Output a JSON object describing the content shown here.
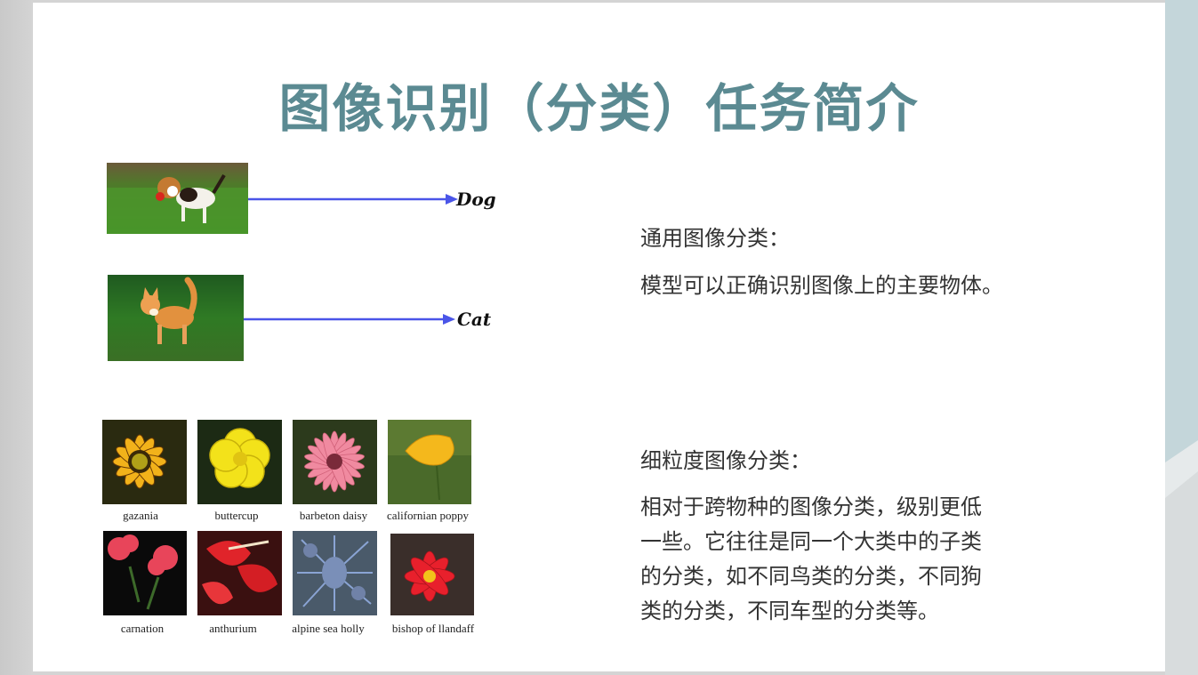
{
  "slide": {
    "title": "图像识别（分类）任务简介"
  },
  "general": {
    "heading": "通用图像分类：",
    "body": "模型可以正确识别图像上的主要物体。"
  },
  "fine_grained": {
    "heading": "细粒度图像分类：",
    "lines": [
      "相对于跨物种的图像分类，级别更低",
      "一些。它往往是同一个大类中的子类",
      "的分类，如不同鸟类的分类，不同狗",
      "类的分类，不同车型的分类等。"
    ]
  },
  "examples": {
    "dog_label": "Dog",
    "cat_label": "Cat",
    "arrow_color": "#4a55e8"
  },
  "flowers": [
    {
      "caption": "gazania"
    },
    {
      "caption": "buttercup"
    },
    {
      "caption": "barbeton daisy"
    },
    {
      "caption": "californian poppy"
    },
    {
      "caption": "carnation"
    },
    {
      "caption": "anthurium"
    },
    {
      "caption": "alpine sea holly"
    },
    {
      "caption": "bishop of llandaff"
    }
  ],
  "colors": {
    "title": "#5b8a92",
    "text": "#333333",
    "background": "#ffffff"
  }
}
